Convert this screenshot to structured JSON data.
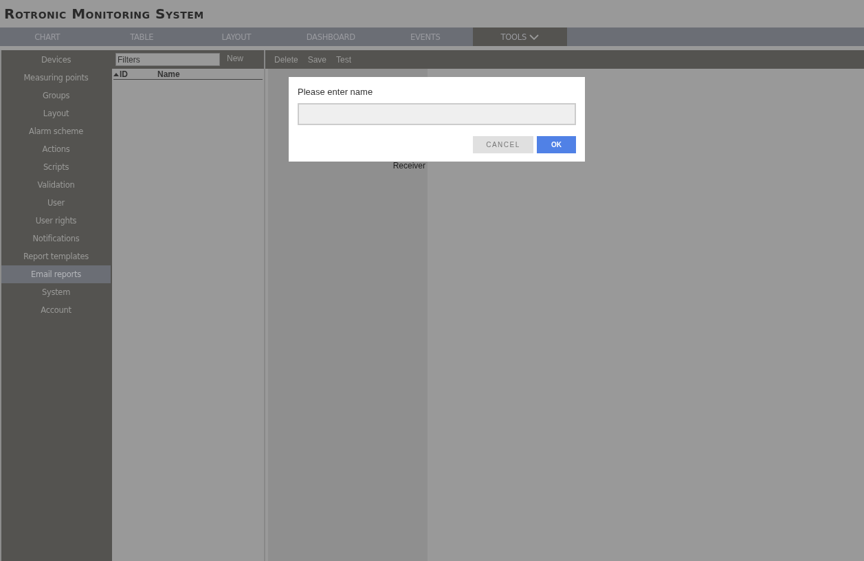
{
  "app_title": "Rotronic Monitoring System",
  "tabs": [
    {
      "label": "CHART",
      "selected": false
    },
    {
      "label": "TABLE",
      "selected": false
    },
    {
      "label": "LAYOUT",
      "selected": false
    },
    {
      "label": "DASHBOARD",
      "selected": false
    },
    {
      "label": "EVENTS",
      "selected": false
    },
    {
      "label": "TOOLS",
      "selected": true,
      "dropdown": true
    }
  ],
  "sidebar": {
    "items": [
      {
        "label": "Devices",
        "selected": false
      },
      {
        "label": "Measuring points",
        "selected": false
      },
      {
        "label": "Groups",
        "selected": false
      },
      {
        "label": "Layout",
        "selected": false
      },
      {
        "label": "Alarm scheme",
        "selected": false
      },
      {
        "label": "Actions",
        "selected": false
      },
      {
        "label": "Scripts",
        "selected": false
      },
      {
        "label": "Validation",
        "selected": false
      },
      {
        "label": "User",
        "selected": false
      },
      {
        "label": "User rights",
        "selected": false
      },
      {
        "label": "Notifications",
        "selected": false
      },
      {
        "label": "Report templates",
        "selected": false
      },
      {
        "label": "Email reports",
        "selected": true
      },
      {
        "label": "System",
        "selected": false
      },
      {
        "label": "Account",
        "selected": false
      }
    ]
  },
  "list_panel": {
    "filter": {
      "placeholder": "Filters"
    },
    "new_button": "New",
    "columns": [
      {
        "label": "ID",
        "sorted": true
      },
      {
        "label": "Name",
        "sorted": false
      }
    ]
  },
  "detail_toolbar": [
    "Delete",
    "Save",
    "Test"
  ],
  "detail_form": {
    "labels": [
      "Receiver"
    ]
  },
  "dialog": {
    "title": "Please enter name",
    "cancel": "CANCEL",
    "ok": "OK"
  }
}
